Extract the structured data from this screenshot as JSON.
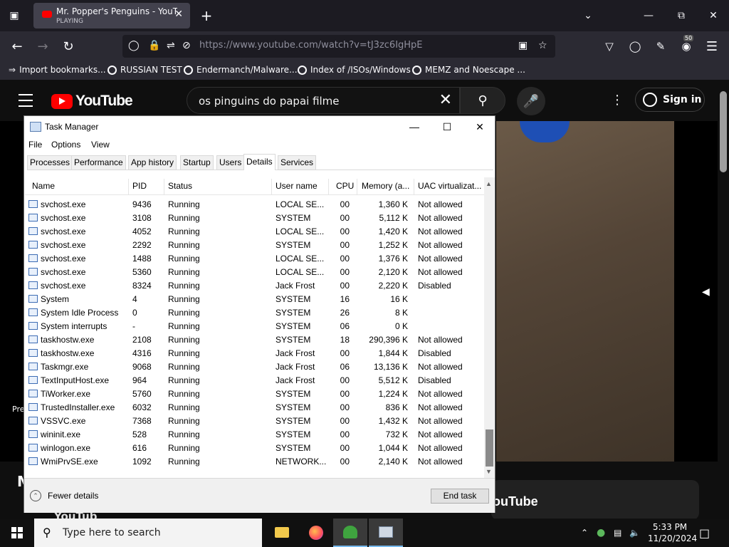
{
  "browser": {
    "tab_title": "Mr. Popper's Penguins - YouTube",
    "tab_status": "PLAYING",
    "url": "https://www.youtube.com/watch?v=tJ3zc6IgHpE",
    "extensions_badge": "50",
    "bookmarks": [
      "Import bookmarks...",
      "RUSSIAN TEST",
      "Endermanch/Malware...",
      "Index of /ISOs/Windows",
      "MEMZ and Noescape ..."
    ]
  },
  "youtube": {
    "logo": "YouTube",
    "search_query": "os pinguins do papai  filme",
    "signin": "Sign in",
    "prev_label": "Pre",
    "below_letter": "M",
    "banner_text": "ouTube",
    "bottom_logo": "YouTub"
  },
  "taskmanager": {
    "title": "Task Manager",
    "menu": [
      "File",
      "Options",
      "View"
    ],
    "tabs": [
      "Processes",
      "Performance",
      "App history",
      "Startup",
      "Users",
      "Details",
      "Services"
    ],
    "active_tab": "Details",
    "columns": [
      "Name",
      "PID",
      "Status",
      "User name",
      "CPU",
      "Memory (a...",
      "UAC virtualizat..."
    ],
    "rows": [
      [
        "svchost.exe",
        "9436",
        "Running",
        "LOCAL SE...",
        "00",
        "1,360 K",
        "Not allowed"
      ],
      [
        "svchost.exe",
        "3108",
        "Running",
        "SYSTEM",
        "00",
        "5,112 K",
        "Not allowed"
      ],
      [
        "svchost.exe",
        "4052",
        "Running",
        "LOCAL SE...",
        "00",
        "1,420 K",
        "Not allowed"
      ],
      [
        "svchost.exe",
        "2292",
        "Running",
        "SYSTEM",
        "00",
        "1,252 K",
        "Not allowed"
      ],
      [
        "svchost.exe",
        "1488",
        "Running",
        "LOCAL SE...",
        "00",
        "1,376 K",
        "Not allowed"
      ],
      [
        "svchost.exe",
        "5360",
        "Running",
        "LOCAL SE...",
        "00",
        "2,120 K",
        "Not allowed"
      ],
      [
        "svchost.exe",
        "8324",
        "Running",
        "Jack Frost",
        "00",
        "2,220 K",
        "Disabled"
      ],
      [
        "System",
        "4",
        "Running",
        "SYSTEM",
        "16",
        "16 K",
        ""
      ],
      [
        "System Idle Process",
        "0",
        "Running",
        "SYSTEM",
        "26",
        "8 K",
        ""
      ],
      [
        "System interrupts",
        "-",
        "Running",
        "SYSTEM",
        "06",
        "0 K",
        ""
      ],
      [
        "taskhostw.exe",
        "2108",
        "Running",
        "SYSTEM",
        "18",
        "290,396 K",
        "Not allowed"
      ],
      [
        "taskhostw.exe",
        "4316",
        "Running",
        "Jack Frost",
        "00",
        "1,844 K",
        "Disabled"
      ],
      [
        "Taskmgr.exe",
        "9068",
        "Running",
        "Jack Frost",
        "06",
        "13,136 K",
        "Not allowed"
      ],
      [
        "TextInputHost.exe",
        "964",
        "Running",
        "Jack Frost",
        "00",
        "5,512 K",
        "Disabled"
      ],
      [
        "TiWorker.exe",
        "5760",
        "Running",
        "SYSTEM",
        "00",
        "1,224 K",
        "Not allowed"
      ],
      [
        "TrustedInstaller.exe",
        "6032",
        "Running",
        "SYSTEM",
        "00",
        "836 K",
        "Not allowed"
      ],
      [
        "VSSVC.exe",
        "7368",
        "Running",
        "SYSTEM",
        "00",
        "1,432 K",
        "Not allowed"
      ],
      [
        "wininit.exe",
        "528",
        "Running",
        "SYSTEM",
        "00",
        "732 K",
        "Not allowed"
      ],
      [
        "winlogon.exe",
        "616",
        "Running",
        "SYSTEM",
        "00",
        "1,044 K",
        "Not allowed"
      ],
      [
        "WmiPrvSE.exe",
        "1092",
        "Running",
        "NETWORK...",
        "00",
        "2,140 K",
        "Not allowed"
      ]
    ],
    "fewer_details": "Fewer details",
    "end_task": "End task"
  },
  "taskbar": {
    "search_placeholder": "Type here to search",
    "time": "5:33 PM",
    "date": "11/20/2024"
  }
}
